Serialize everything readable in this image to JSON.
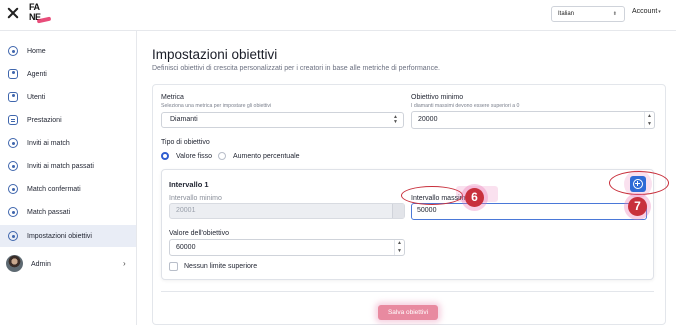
{
  "header": {
    "logo_line1": "FA",
    "logo_line2": "NE",
    "language": "Italian",
    "account_label": "Account"
  },
  "sidebar": {
    "items": [
      {
        "label": "Home",
        "icon": "home-icon"
      },
      {
        "label": "Agenti",
        "icon": "person-icon"
      },
      {
        "label": "Utenti",
        "icon": "person-icon"
      },
      {
        "label": "Prestazioni",
        "icon": "document-icon"
      },
      {
        "label": "Inviti ai match",
        "icon": "invite-icon"
      },
      {
        "label": "Inviti ai match passati",
        "icon": "invite-icon"
      },
      {
        "label": "Match confermati",
        "icon": "match-icon"
      },
      {
        "label": "Match passati",
        "icon": "match-icon"
      },
      {
        "label": "Impostazioni obiettivi",
        "icon": "settings-icon",
        "active": true
      }
    ],
    "admin_label": "Admin"
  },
  "main": {
    "title": "Impostazioni obiettivi",
    "subtitle": "Definisci obiettivi di crescita personalizzati per i creatori in base alle metriche di performance.",
    "metric": {
      "label": "Metrica",
      "hint": "Seleziona una metrica per impostare gli obiettivi",
      "value": "Diamanti"
    },
    "min_objective": {
      "label": "Obiettivo minimo",
      "hint": "I diamanti massimi devono essere superiori a 0",
      "value": "20000"
    },
    "objective_type": {
      "label": "Tipo di obiettivo",
      "options": [
        "Valore fisso",
        "Aumento percentuale"
      ],
      "selected": "Valore fisso"
    },
    "interval": {
      "title": "Intervallo 1",
      "min_label": "Intervallo minimo",
      "min_value": "20001",
      "max_label": "Intervallo massimo",
      "max_value": "50000",
      "target_label": "Valore dell'obiettivo",
      "target_value": "60000",
      "no_limit_label": "Nessun limite superiore"
    },
    "save_label": "Salva obiettivi"
  },
  "annotations": {
    "badge_6": "6",
    "badge_7": "7"
  },
  "colors": {
    "accent": "#2f6bd6",
    "radio_selected": "#2f5dd0",
    "sidebar_active": "#e9edf6",
    "save_button": "#e88aa0",
    "annotation_red": "#c8303c"
  }
}
